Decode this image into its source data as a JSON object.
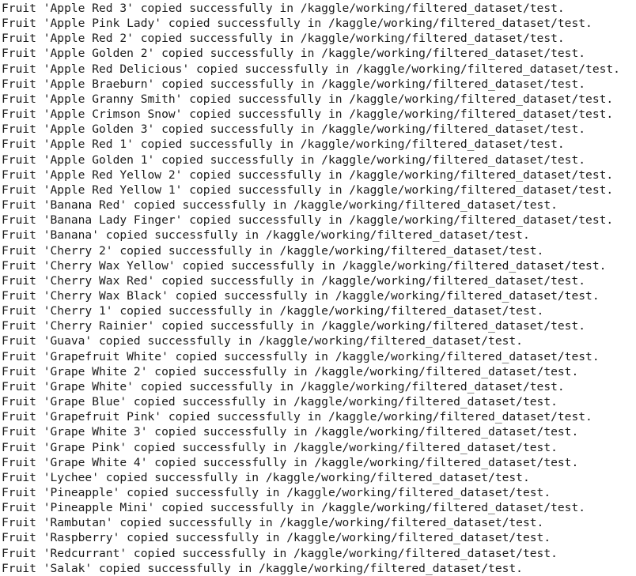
{
  "console": {
    "type": "notebook-cell-stdout",
    "background_color": "#ffffff",
    "text_color": "#1b1b1b",
    "font": "monospace",
    "message_template": "Fruit '{name}' copied successfully in {destination}",
    "destination_path": "/kaggle/working/filtered_dataset/test.",
    "line_count": 37,
    "lines": [
      "Fruit 'Apple Red 3' copied successfully in /kaggle/working/filtered_dataset/test.",
      "Fruit 'Apple Pink Lady' copied successfully in /kaggle/working/filtered_dataset/test.",
      "Fruit 'Apple Red 2' copied successfully in /kaggle/working/filtered_dataset/test.",
      "Fruit 'Apple Golden 2' copied successfully in /kaggle/working/filtered_dataset/test.",
      "Fruit 'Apple Red Delicious' copied successfully in /kaggle/working/filtered_dataset/test.",
      "Fruit 'Apple Braeburn' copied successfully in /kaggle/working/filtered_dataset/test.",
      "Fruit 'Apple Granny Smith' copied successfully in /kaggle/working/filtered_dataset/test.",
      "Fruit 'Apple Crimson Snow' copied successfully in /kaggle/working/filtered_dataset/test.",
      "Fruit 'Apple Golden 3' copied successfully in /kaggle/working/filtered_dataset/test.",
      "Fruit 'Apple Red 1' copied successfully in /kaggle/working/filtered_dataset/test.",
      "Fruit 'Apple Golden 1' copied successfully in /kaggle/working/filtered_dataset/test.",
      "Fruit 'Apple Red Yellow 2' copied successfully in /kaggle/working/filtered_dataset/test.",
      "Fruit 'Apple Red Yellow 1' copied successfully in /kaggle/working/filtered_dataset/test.",
      "Fruit 'Banana Red' copied successfully in /kaggle/working/filtered_dataset/test.",
      "Fruit 'Banana Lady Finger' copied successfully in /kaggle/working/filtered_dataset/test.",
      "Fruit 'Banana' copied successfully in /kaggle/working/filtered_dataset/test.",
      "Fruit 'Cherry 2' copied successfully in /kaggle/working/filtered_dataset/test.",
      "Fruit 'Cherry Wax Yellow' copied successfully in /kaggle/working/filtered_dataset/test.",
      "Fruit 'Cherry Wax Red' copied successfully in /kaggle/working/filtered_dataset/test.",
      "Fruit 'Cherry Wax Black' copied successfully in /kaggle/working/filtered_dataset/test.",
      "Fruit 'Cherry 1' copied successfully in /kaggle/working/filtered_dataset/test.",
      "Fruit 'Cherry Rainier' copied successfully in /kaggle/working/filtered_dataset/test.",
      "Fruit 'Guava' copied successfully in /kaggle/working/filtered_dataset/test.",
      "Fruit 'Grapefruit White' copied successfully in /kaggle/working/filtered_dataset/test.",
      "Fruit 'Grape White 2' copied successfully in /kaggle/working/filtered_dataset/test.",
      "Fruit 'Grape White' copied successfully in /kaggle/working/filtered_dataset/test.",
      "Fruit 'Grape Blue' copied successfully in /kaggle/working/filtered_dataset/test.",
      "Fruit 'Grapefruit Pink' copied successfully in /kaggle/working/filtered_dataset/test.",
      "Fruit 'Grape White 3' copied successfully in /kaggle/working/filtered_dataset/test.",
      "Fruit 'Grape Pink' copied successfully in /kaggle/working/filtered_dataset/test.",
      "Fruit 'Grape White 4' copied successfully in /kaggle/working/filtered_dataset/test.",
      "Fruit 'Lychee' copied successfully in /kaggle/working/filtered_dataset/test.",
      "Fruit 'Pineapple' copied successfully in /kaggle/working/filtered_dataset/test.",
      "Fruit 'Pineapple Mini' copied successfully in /kaggle/working/filtered_dataset/test.",
      "Fruit 'Rambutan' copied successfully in /kaggle/working/filtered_dataset/test.",
      "Fruit 'Raspberry' copied successfully in /kaggle/working/filtered_dataset/test.",
      "Fruit 'Redcurrant' copied successfully in /kaggle/working/filtered_dataset/test.",
      "Fruit 'Salak' copied successfully in /kaggle/working/filtered_dataset/test."
    ]
  }
}
